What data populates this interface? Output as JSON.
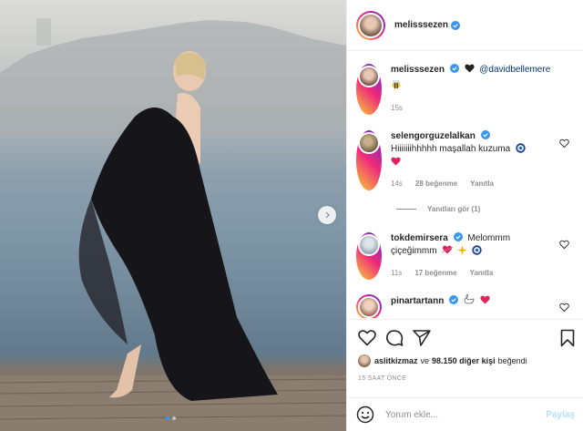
{
  "post": {
    "username": "melisssezen",
    "caption_mention": "@davidbellemere",
    "caption_time": "15s",
    "likes_user": "aslitkizmaz",
    "likes_joiner": "ve",
    "likes_count": "98.150 diğer kişi",
    "likes_suffix": "beğendi",
    "timestamp": "15 SAAT ÖNCE",
    "carousel_dots": 2
  },
  "comments": [
    {
      "username": "selengorguzelalkan",
      "text": "Hiiiiiiihhhhh maşallah kuzuma",
      "time": "14s",
      "likes": "28 beğenme",
      "reply": "Yanıtla",
      "view_replies": "Yanıtları gör (1)"
    },
    {
      "username": "tokdemirsera",
      "text_line1": "Melommm",
      "text_line2": "çiçeğimmm",
      "time": "11s",
      "likes": "17 beğenme",
      "reply": "Yanıtla"
    },
    {
      "username": "pinartartann"
    }
  ],
  "add_comment": {
    "placeholder": "Yorum ekle...",
    "post_label": "Paylaş"
  },
  "colors": {
    "verified": "#3897f0",
    "heart": "#ed4956",
    "post_disabled": "#b2dffc",
    "muted": "#8e8e8e"
  }
}
